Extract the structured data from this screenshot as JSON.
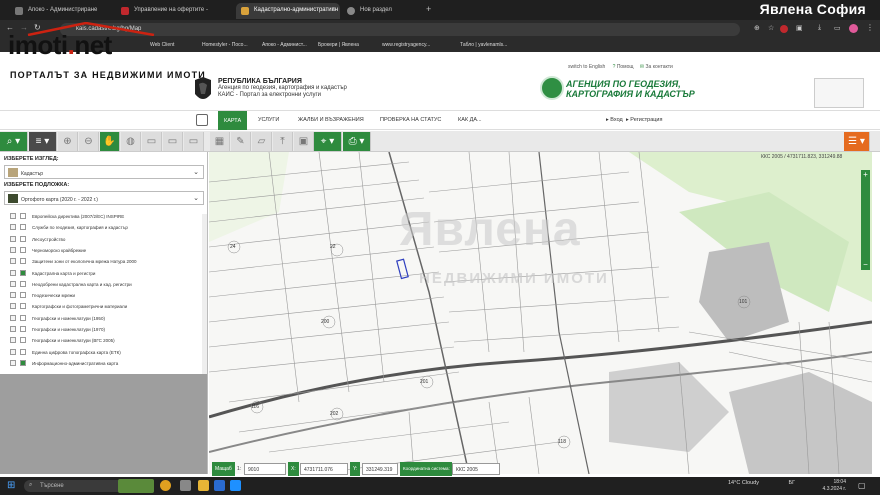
{
  "browser": {
    "tabs": [
      {
        "label": "Апоко - Администриране",
        "color": "#7a7a7a"
      },
      {
        "label": "Управление на офертите -",
        "color": "#c0282d"
      },
      {
        "label": "Кадастрално-административн",
        "color": "#d9a23b"
      },
      {
        "label": "Нов раздел",
        "color": "#888"
      }
    ],
    "active_tab": 2,
    "brand_overlay": "Явлена София",
    "url": "kais.cadastre.bg/bg/Map",
    "bookmarks": [
      "Apoko BO",
      "Web Client",
      "Homestyler - Посо...",
      "Апоко - Админист...",
      "Брокери | Явлена",
      "www.registryagency...",
      "Табло | yavlenamls..."
    ]
  },
  "imoti_logo": {
    "name_a": "imoti",
    "name_dot": ".",
    "name_b": "net",
    "tagline": "ПОРТАЛЪТ ЗА НЕДВИЖИМИ ИМОТИ"
  },
  "site": {
    "republic": "РЕПУБЛИКА БЪЛГАРИЯ",
    "agency_line": "Агенция по геодезия, картография и кадастър",
    "kais_line": "КАИС - Портал за електронни услуги",
    "lang": "switch to English",
    "help": "Помощ",
    "contact": "За контакти",
    "agency_name_1": "АГЕНЦИЯ ПО ГЕОДЕЗИЯ,",
    "agency_name_2": "КАРТОГРАФИЯ И КАДАСТЪР",
    "nav": [
      "КАРТА",
      "УСЛУГИ",
      "ЖАЛБИ И ВЪЗРАЖЕНИЯ",
      "ПРОВЕРКА НА СТАТУС",
      "КАК ДА..."
    ],
    "login": "Вход",
    "register": "Регистрация"
  },
  "panel": {
    "view_label": "ИЗБЕРЕТЕ ИЗГЛЕД:",
    "view_value": "Кадастър",
    "base_label": "ИЗБЕРЕТЕ ПОДЛОЖКА:",
    "base_value": "Ортофото карта (2020 г. - 2022 г.)",
    "layers": [
      {
        "label": "Европейска директива (2007/2/ЕС) INSPIRE",
        "on": false
      },
      {
        "label": "Служби по геодезия, картография и кадастър",
        "on": false
      },
      {
        "label": "Лесоустройство",
        "on": false
      },
      {
        "label": "Черноморско крайбрежие",
        "on": false
      },
      {
        "label": "Защитени зони от екологична мрежа Натура 2000",
        "on": false
      },
      {
        "label": "Кадастрална карта и регистри",
        "on": true
      },
      {
        "label": "Неодобрени кадастрална карта и кад. регистри",
        "on": false
      },
      {
        "label": "Геодезически мрежи",
        "on": false
      },
      {
        "label": "Картографски и фотограметрични материали",
        "on": false
      },
      {
        "label": "Географски и номенклатури (1950)",
        "on": false
      },
      {
        "label": "Географски и номенклатури (1970)",
        "on": false
      },
      {
        "label": "Географски и номенклатури (ВГС 2005)",
        "on": false
      },
      {
        "label": "Единна цифрова топографска карта (ЕТК)",
        "on": false
      },
      {
        "label": "Информационно-административна карта",
        "on": true
      }
    ]
  },
  "map": {
    "top_coords": "ККС 2005 / 4731711.823, 331249.88",
    "watermark": "Явлена",
    "watermark_sub": "НЕДВИЖИМИ ИМОТИ",
    "parcel_labels": [
      "22",
      "24",
      "201",
      "200",
      "202",
      "118",
      "116",
      "24",
      "101"
    ]
  },
  "coords": {
    "scale_label": "Мащаб",
    "scale_sep": "1:",
    "scale_value": "9010",
    "x_label": "X:",
    "x_value": "4731711.076",
    "y_label": "Y:",
    "y_value": "331249.319",
    "system_label": "Координатна система:",
    "system_value": "ККС 2005"
  },
  "taskbar": {
    "search": "Търсене",
    "weather": "14°C  Cloudy",
    "lang": "БГ",
    "time": "18:04",
    "date": "4.3.2024 г."
  },
  "colors": {
    "green": "#2e8b3e",
    "accent_orange": "#e56b1f"
  }
}
